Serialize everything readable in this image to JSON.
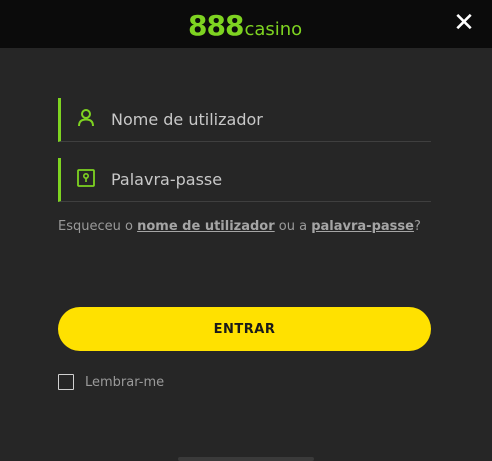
{
  "header": {
    "logo_number": "888",
    "logo_word": "casino",
    "close_glyph": "✕"
  },
  "form": {
    "username_placeholder": "Nome de utilizador",
    "password_placeholder": "Palavra-passe",
    "forgot_prefix": "Esqueceu o ",
    "forgot_username_link": "nome de utilizador",
    "forgot_middle": " ou a ",
    "forgot_password_link": "palavra-passe",
    "forgot_suffix": "?",
    "login_button": "ENTRAR",
    "remember_label": "Lembrar-me"
  },
  "icons": {
    "username": "user-icon",
    "password": "lock-icon",
    "close": "close-icon"
  },
  "colors": {
    "accent_green": "#7ed321",
    "button_yellow": "#ffe100",
    "background": "#262626",
    "header": "#0b0b0b"
  }
}
